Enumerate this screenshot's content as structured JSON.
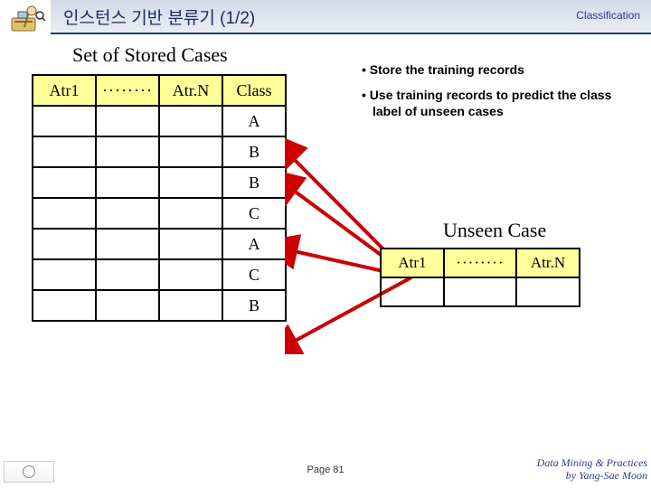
{
  "header": {
    "title": "인스턴스 기반 분류기 (1/2)",
    "category": "Classification"
  },
  "stored": {
    "title": "Set of Stored Cases",
    "columns": {
      "c1": "Atr1",
      "c2": "········",
      "c3": "Atr.N",
      "c4": "Class"
    },
    "rows": [
      "A",
      "B",
      "B",
      "C",
      "A",
      "C",
      "B"
    ]
  },
  "unseen": {
    "title": "Unseen Case",
    "columns": {
      "u1": "Atr1",
      "u2": "········",
      "u3": "Atr.N"
    }
  },
  "bullets": {
    "b1": "• Store the training records",
    "b2": "• Use training records to predict the class label of unseen cases"
  },
  "footer": {
    "page": "Page 81",
    "credit1": "Data Mining & Practices",
    "credit2": "by Yang-Sae Moon"
  }
}
